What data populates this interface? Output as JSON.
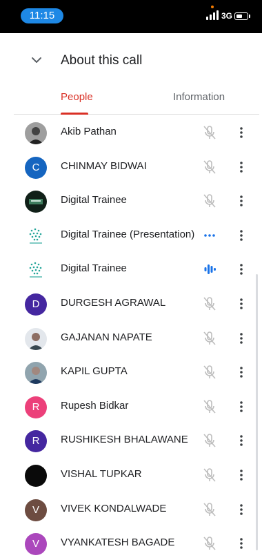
{
  "status_bar": {
    "time": "11:15",
    "network": "3G",
    "icons": [
      "signal-icon",
      "battery-icon"
    ]
  },
  "header": {
    "title": "About this call",
    "icon": "chevron-down-icon"
  },
  "tabs": [
    {
      "label": "People",
      "active": true
    },
    {
      "label": "Information",
      "active": false
    }
  ],
  "colors": {
    "accent": "#d93025",
    "status_bar_time": "#1e88e5",
    "speaking": "#1a73e8"
  },
  "participants": [
    {
      "name": "Akib Pathan",
      "avatar": "photo",
      "status": "muted"
    },
    {
      "name": "CHINMAY BIDWAI",
      "avatar": "initial",
      "initial": "C",
      "color": "#1565c0",
      "status": "muted"
    },
    {
      "name": "Digital Trainee",
      "avatar": "photo-dark",
      "status": "muted"
    },
    {
      "name": "Digital Trainee (Presentation)",
      "avatar": "logo",
      "status": "presenting"
    },
    {
      "name": "Digital Trainee",
      "avatar": "logo",
      "status": "speaking"
    },
    {
      "name": "DURGESH AGRAWAL",
      "avatar": "initial",
      "initial": "D",
      "color": "#4527a0",
      "status": "muted"
    },
    {
      "name": "GAJANAN NAPATE",
      "avatar": "photo-light",
      "status": "muted"
    },
    {
      "name": "KAPIL GUPTA",
      "avatar": "photo-blue",
      "status": "muted"
    },
    {
      "name": "Rupesh Bidkar",
      "avatar": "initial",
      "initial": "R",
      "color": "#ec407a",
      "status": "muted"
    },
    {
      "name": "RUSHIKESH BHALAWANE",
      "avatar": "initial",
      "initial": "R",
      "color": "#4527a0",
      "status": "muted"
    },
    {
      "name": "VISHAL TUPKAR",
      "avatar": "black",
      "status": "muted"
    },
    {
      "name": "VIVEK KONDALWADE",
      "avatar": "initial",
      "initial": "V",
      "color": "#6d4c41",
      "status": "muted"
    },
    {
      "name": "VYANKATESH BAGADE",
      "avatar": "initial",
      "initial": "V",
      "color": "#ab47bc",
      "status": "muted"
    }
  ]
}
